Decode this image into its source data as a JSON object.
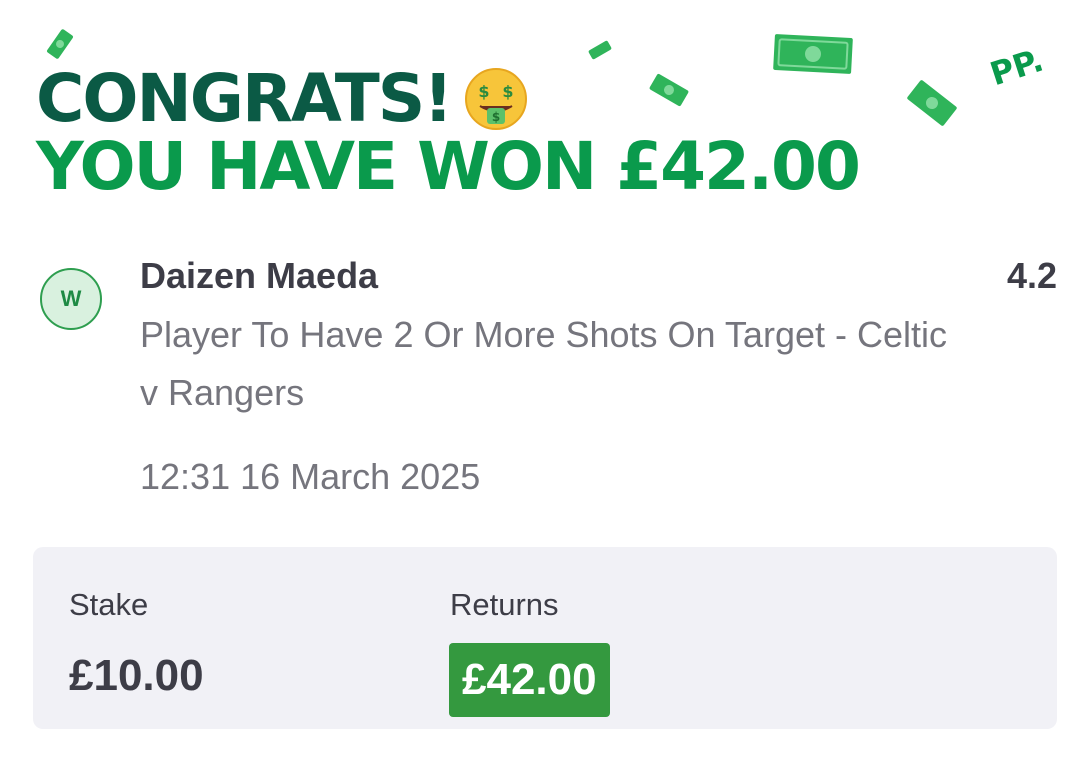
{
  "header": {
    "congrats": "CONGRATS!",
    "won_text": "YOU HAVE WON £42.00",
    "emoji": "money-mouth-face-icon",
    "brand": "PP."
  },
  "bet": {
    "result_badge": "W",
    "selection_name": "Daizen Maeda",
    "market": "Player To Have 2 Or More Shots On Target - Celtic v Rangers",
    "odds": "4.2",
    "datetime": "12:31 16 March 2025"
  },
  "summary": {
    "stake_label": "Stake",
    "stake_value": "£10.00",
    "returns_label": "Returns",
    "returns_value": "£42.00"
  },
  "colors": {
    "dark_green": "#0b5a45",
    "bright_green": "#0a9a4c",
    "returns_green": "#34993f",
    "panel_bg": "#f1f1f6"
  }
}
